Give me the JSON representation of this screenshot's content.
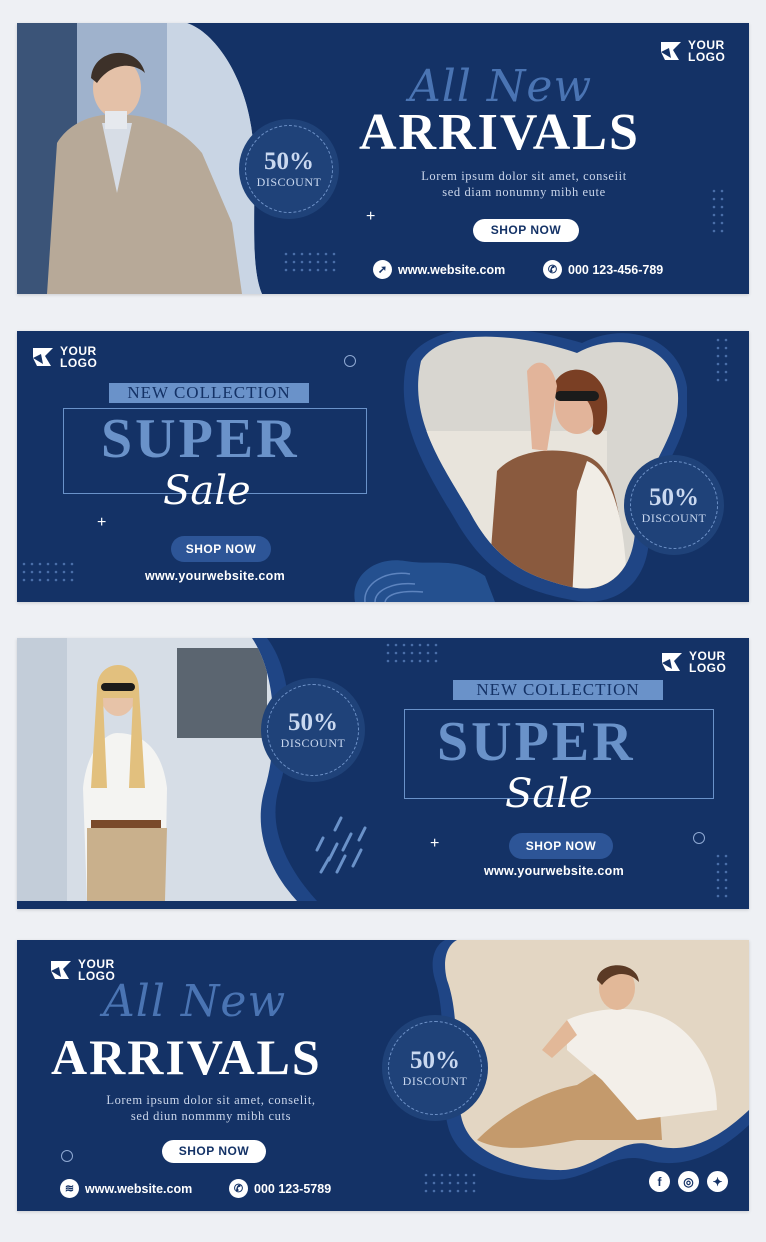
{
  "banners": [
    {
      "logo": {
        "line1": "YOUR",
        "line2": "LOGO"
      },
      "script_title": "All New",
      "title": "ARRIVALS",
      "lorem": [
        "Lorem ipsum dolor sit amet, conseiit",
        "sed diam nonumny mibh eute"
      ],
      "discount": {
        "percent": "50%",
        "label": "DISCOUNT"
      },
      "button": "SHOP NOW",
      "website": "www.website.com",
      "phone": "000 123-456-789"
    },
    {
      "logo": {
        "line1": "YOUR",
        "line2": "LOGO"
      },
      "tag": "NEW COLLECTION",
      "super": "SUPER",
      "sale": "Sale",
      "button": "SHOP NOW",
      "website": "www.yourwebsite.com",
      "discount": {
        "percent": "50%",
        "label": "DISCOUNT"
      }
    },
    {
      "logo": {
        "line1": "YOUR",
        "line2": "LOGO"
      },
      "tag": "NEW COLLECTION",
      "super": "SUPER",
      "sale": "Sale",
      "button": "SHOP NOW",
      "website": "www.yourwebsite.com",
      "discount": {
        "percent": "50%",
        "label": "DISCOUNT"
      }
    },
    {
      "logo": {
        "line1": "YOUR",
        "line2": "LOGO"
      },
      "script_title": "All New",
      "title": "ARRIVALS",
      "lorem": [
        "Lorem ipsum dolor sit amet, conselit,",
        "sed diun nommmy mibh cuts"
      ],
      "discount": {
        "percent": "50%",
        "label": "DISCOUNT"
      },
      "button": "SHOP NOW",
      "website": "www.website.com",
      "phone": "000  123-5789",
      "social_icons": [
        "facebook-icon",
        "instagram-icon",
        "twitter-icon"
      ]
    }
  ],
  "colors": {
    "navy": "#143266",
    "accent": "#6a92c9",
    "white": "#ffffff"
  }
}
